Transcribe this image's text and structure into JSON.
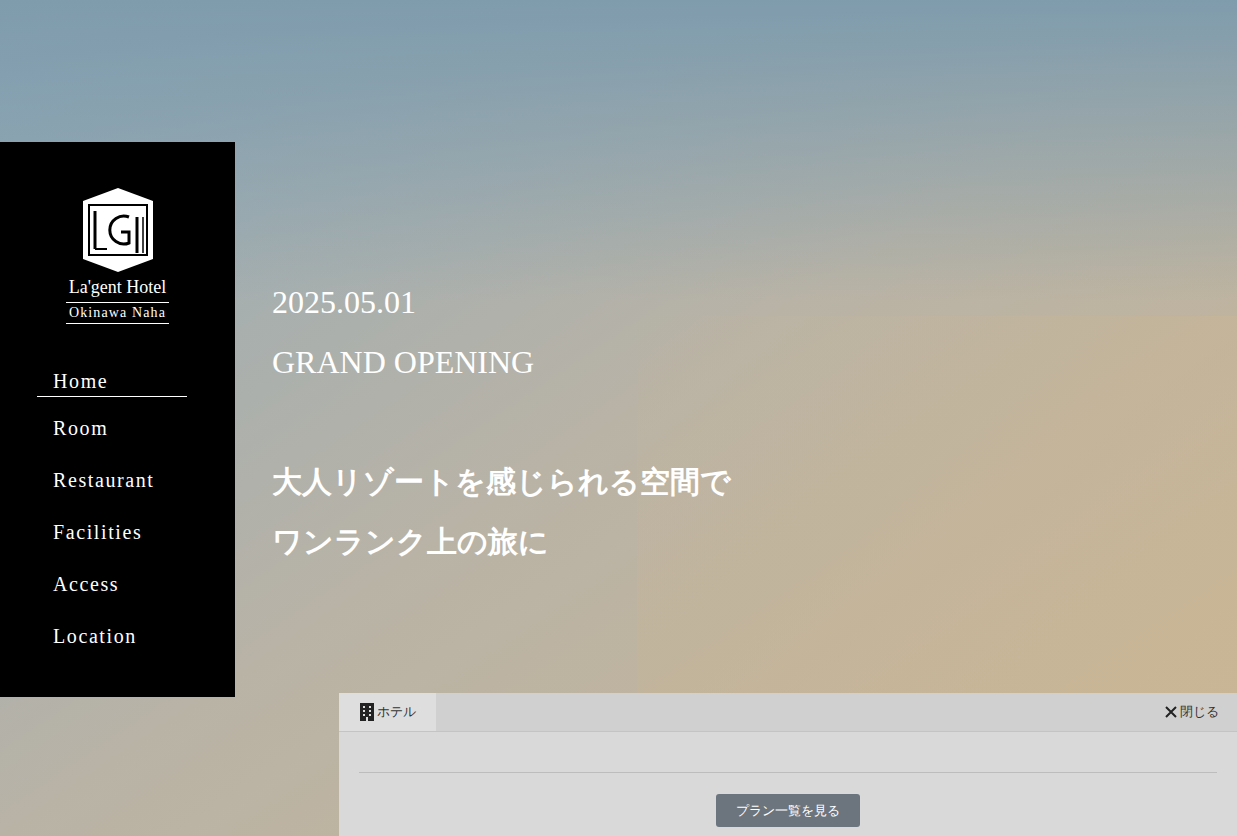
{
  "logo": {
    "name": "La'gent Hotel",
    "location": "Okinawa Naha"
  },
  "nav": [
    {
      "label": "Home",
      "selected": true
    },
    {
      "label": "Room",
      "selected": false
    },
    {
      "label": "Restaurant",
      "selected": false
    },
    {
      "label": "Facilities",
      "selected": false
    },
    {
      "label": "Access",
      "selected": false
    },
    {
      "label": "Location",
      "selected": false
    }
  ],
  "hero": {
    "date": "2025.05.01",
    "headline": "GRAND OPENING",
    "tagline": [
      "大人リゾートを感じられる空間で",
      "ワンランク上の旅に"
    ]
  },
  "booking": {
    "tabs": [
      {
        "label": "ホテル",
        "selected": true
      }
    ],
    "close": "閉じる",
    "button": "プラン一覧を見る"
  }
}
